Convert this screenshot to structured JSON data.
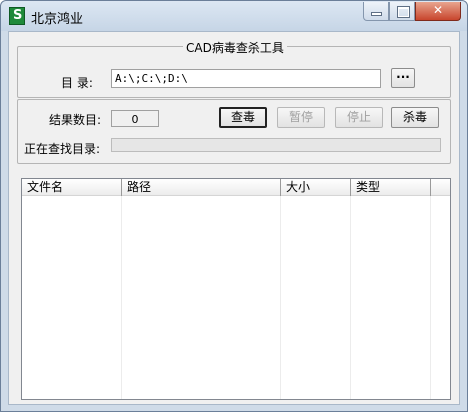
{
  "window": {
    "title": "北京鸿业"
  },
  "scan_group": {
    "title": "CAD病毒查杀工具",
    "directory_label": "目  录:",
    "directory_value": "A:\\;C:\\;D:\\",
    "browse_label": "···"
  },
  "status": {
    "result_count_label": "结果数目:",
    "result_count_value": "0",
    "searching_dir_label": "正在查找目录:",
    "searching_dir_value": ""
  },
  "actions": {
    "scan_label": "查毒",
    "pause_label": "暂停",
    "stop_label": "停止",
    "kill_label": "杀毒"
  },
  "results_table": {
    "columns": [
      "文件名",
      "路径",
      "大小",
      "类型"
    ],
    "rows": []
  }
}
